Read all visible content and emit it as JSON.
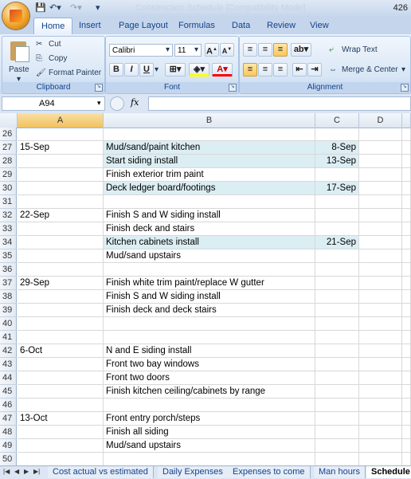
{
  "window": {
    "title_fragment": "426",
    "title_ghost": "Construction Schedule [Compatibility Mode]"
  },
  "quick_access": {
    "save_icon": "save-icon",
    "undo_icon": "undo-icon",
    "redo_icon": "redo-icon"
  },
  "tabs": [
    "Home",
    "Insert",
    "Page Layout",
    "Formulas",
    "Data",
    "Review",
    "View"
  ],
  "ribbon": {
    "clipboard": {
      "paste": "Paste",
      "cut": "Cut",
      "copy": "Copy",
      "format_painter": "Format Painter",
      "label": "Clipboard"
    },
    "font": {
      "name": "Calibri",
      "size": "11",
      "bold": "B",
      "italic": "I",
      "underline": "U",
      "label": "Font"
    },
    "alignment": {
      "wrap_text": "Wrap Text",
      "merge_center": "Merge & Center",
      "label": "Alignment"
    }
  },
  "formula_bar": {
    "name_box": "A94",
    "fx": "fx",
    "value": ""
  },
  "columns": [
    "A",
    "B",
    "C",
    "D"
  ],
  "rows": [
    {
      "n": "26",
      "a": "",
      "b": "",
      "c": "",
      "hl": false
    },
    {
      "n": "27",
      "a": "15-Sep",
      "b": "Mud/sand/paint kitchen",
      "c": "8-Sep",
      "hl": true
    },
    {
      "n": "28",
      "a": "",
      "b": "Start siding install",
      "c": "13-Sep",
      "hl": true
    },
    {
      "n": "29",
      "a": "",
      "b": "Finish exterior trim paint",
      "c": "",
      "hl": false
    },
    {
      "n": "30",
      "a": "",
      "b": "Deck ledger board/footings",
      "c": "17-Sep",
      "hl": true
    },
    {
      "n": "31",
      "a": "",
      "b": "",
      "c": "",
      "hl": false
    },
    {
      "n": "32",
      "a": "22-Sep",
      "b": "Finish S and W siding install",
      "c": "",
      "hl": false
    },
    {
      "n": "33",
      "a": "",
      "b": "Finish deck and stairs",
      "c": "",
      "hl": false
    },
    {
      "n": "34",
      "a": "",
      "b": "Kitchen cabinets install",
      "c": "21-Sep",
      "hl": true
    },
    {
      "n": "35",
      "a": "",
      "b": "Mud/sand upstairs",
      "c": "",
      "hl": false
    },
    {
      "n": "36",
      "a": "",
      "b": "",
      "c": "",
      "hl": false
    },
    {
      "n": "37",
      "a": "29-Sep",
      "b": "Finish white trim paint/replace W gutter",
      "c": "",
      "hl": false
    },
    {
      "n": "38",
      "a": "",
      "b": "Finish S and W siding install",
      "c": "",
      "hl": false
    },
    {
      "n": "39",
      "a": "",
      "b": "Finish deck and deck stairs",
      "c": "",
      "hl": false
    },
    {
      "n": "40",
      "a": "",
      "b": "",
      "c": "",
      "hl": false
    },
    {
      "n": "41",
      "a": "",
      "b": "",
      "c": "",
      "hl": false
    },
    {
      "n": "42",
      "a": "6-Oct",
      "b": "N and E siding install",
      "c": "",
      "hl": false
    },
    {
      "n": "43",
      "a": "",
      "b": "Front two bay windows",
      "c": "",
      "hl": false
    },
    {
      "n": "44",
      "a": "",
      "b": "Front two doors",
      "c": "",
      "hl": false
    },
    {
      "n": "45",
      "a": "",
      "b": "Finish kitchen ceiling/cabinets by range",
      "c": "",
      "hl": false
    },
    {
      "n": "46",
      "a": "",
      "b": "",
      "c": "",
      "hl": false
    },
    {
      "n": "47",
      "a": "13-Oct",
      "b": "Front entry porch/steps",
      "c": "",
      "hl": false
    },
    {
      "n": "48",
      "a": "",
      "b": "Finish all siding",
      "c": "",
      "hl": false
    },
    {
      "n": "49",
      "a": "",
      "b": "Mud/sand upstairs",
      "c": "",
      "hl": false
    },
    {
      "n": "50",
      "a": "",
      "b": "",
      "c": "",
      "hl": false
    }
  ],
  "sheet_tabs": [
    "Cost actual vs estimated",
    "Daily Expenses",
    "Expenses to come",
    "Man hours",
    "Schedule"
  ],
  "active_sheet": "Schedule",
  "colors": {
    "highlight": "#dbeef3",
    "ribbon": "#dae6f4",
    "selected_col": "#f1c15f"
  }
}
